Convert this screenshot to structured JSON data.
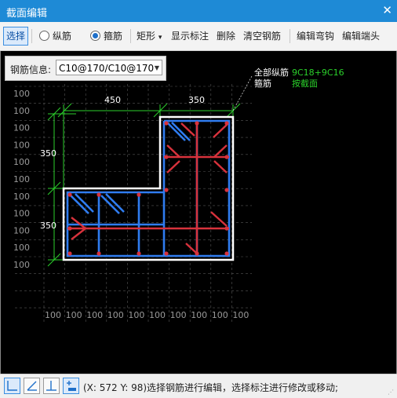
{
  "window": {
    "title": "截面编辑",
    "close_label": "✕"
  },
  "toolbar": {
    "select": "选择",
    "longitudinal": "纵筋",
    "stirrup": "箍筋",
    "shape": "矩形",
    "shape_arrow": "▾",
    "show_dims": "显示标注",
    "delete": "删除",
    "clear_rebar": "清空钢筋",
    "edit_hook": "编辑弯钩",
    "edit_end": "编辑端头"
  },
  "rebar_info": {
    "label": "钢筋信息:",
    "value": "C10@170/C10@170",
    "arrow": "▼"
  },
  "drawing": {
    "dim_top_left": "450",
    "dim_top_right": "350",
    "dim_left_upper": "350",
    "dim_left_lower": "350",
    "grid_label": "100",
    "legend_all_long_label": "全部纵筋",
    "legend_all_long_value": "9C18+9C16",
    "legend_stirrup_label": "箍筋",
    "legend_stirrup_value": "按截面"
  },
  "colors": {
    "titlebar": "#1e8ad6",
    "dim_green": "#2bd12b",
    "rebar_blue": "#2f7cf0",
    "rebar_red": "#d8323c",
    "concrete_white": "#ffffff"
  },
  "statusbar": {
    "coords": "(X: 572 Y: 98)",
    "message": "选择钢筋进行编辑，选择标注进行修改或移动;"
  }
}
